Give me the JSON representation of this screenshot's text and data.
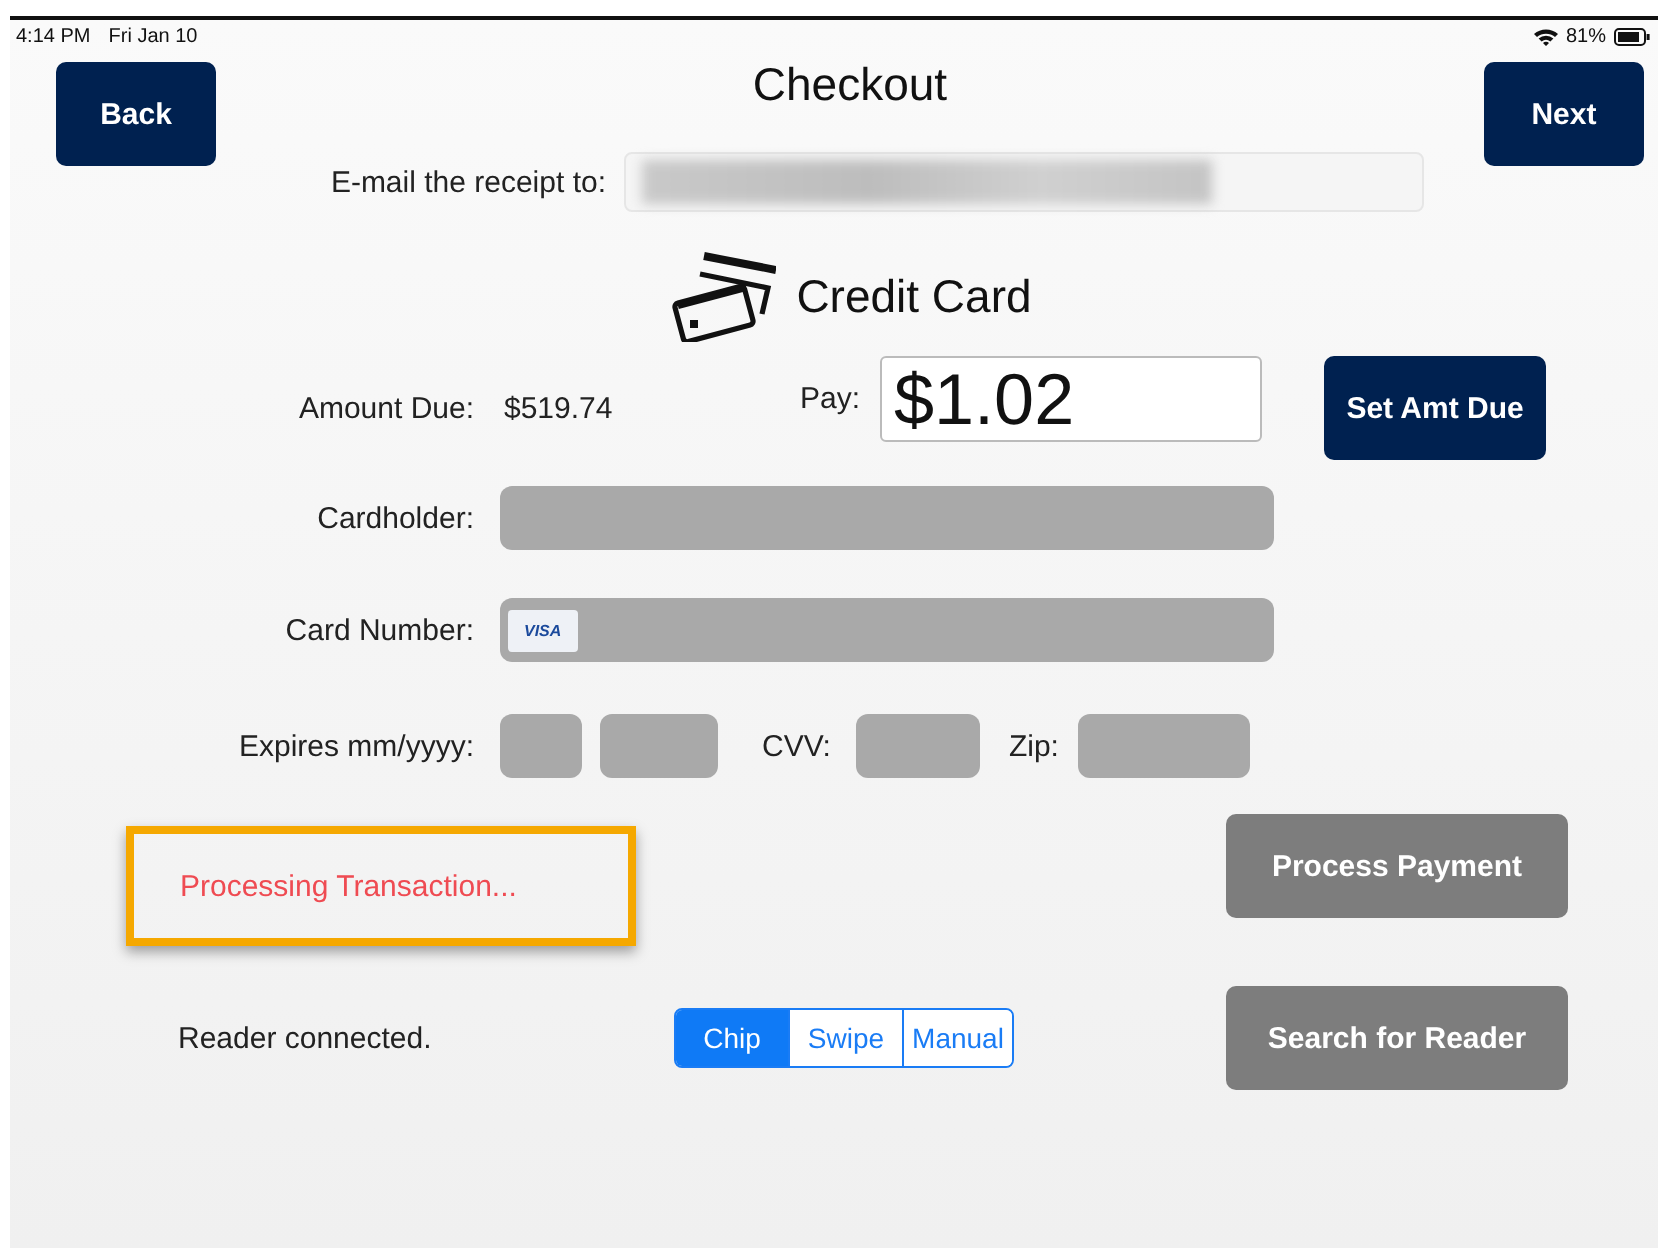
{
  "status_bar": {
    "time": "4:14 PM",
    "date": "Fri Jan 10",
    "battery": "81%"
  },
  "header": {
    "back": "Back",
    "title": "Checkout",
    "next": "Next"
  },
  "email": {
    "label": "E-mail the receipt to:",
    "redacted": true
  },
  "payment_method": {
    "label": "Credit Card"
  },
  "amount": {
    "due_label": "Amount Due:",
    "due_value": "$519.74",
    "pay_label": "Pay:",
    "pay_value": "$1.02",
    "set_button": "Set Amt Due"
  },
  "card_fields": [
    {
      "kind": "wide",
      "label": "Cardholder:",
      "disabled": true
    },
    {
      "kind": "card",
      "label": "Card Number:",
      "disabled": true,
      "brand": "VISA"
    }
  ],
  "expiry": {
    "label": "Expires mm/yyyy:",
    "cvv_label": "CVV:",
    "zip_label": "Zip:",
    "disabled": true
  },
  "processing": {
    "message": "Processing Transaction...",
    "highlighted": true
  },
  "process_button": {
    "label": "Process Payment",
    "disabled": true
  },
  "reader": {
    "status": "Reader connected.",
    "search_button": "Search for Reader",
    "search_disabled": true
  },
  "modes": [
    {
      "label": "Chip",
      "selected": true
    },
    {
      "label": "Swipe",
      "selected": false
    },
    {
      "label": "Manual",
      "selected": false
    }
  ]
}
